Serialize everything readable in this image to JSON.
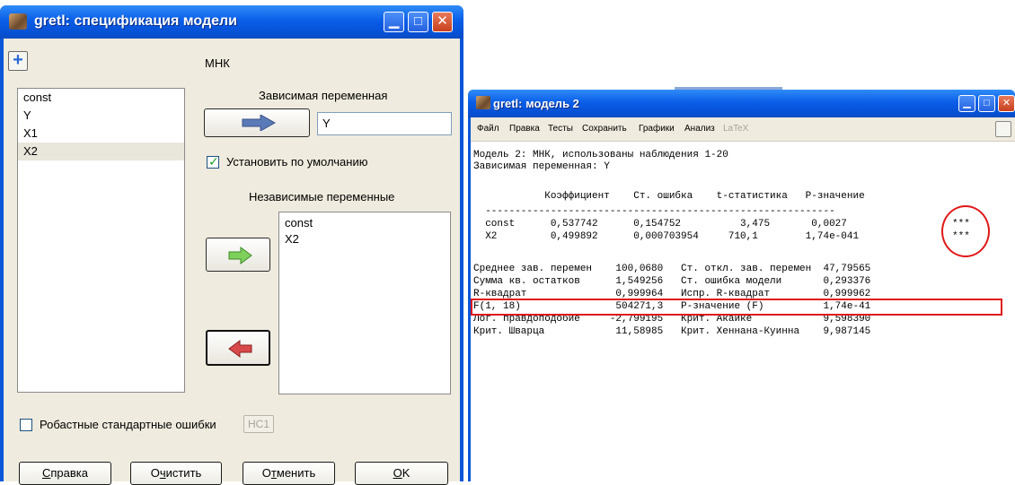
{
  "spec_window": {
    "title": "gretl: спецификация модели",
    "method": "МНК",
    "vars_list": [
      "const",
      "Y",
      "X1",
      "X2"
    ],
    "dep_label": "Зависимая переменная",
    "dep_value": "Y",
    "default_label": "Установить по умолчанию",
    "indep_label": "Независимые переменные",
    "indep_list": [
      "const",
      "X2"
    ],
    "robust_label": "Робастные стандартные ошибки",
    "hc1_label": "HC1",
    "buttons": {
      "help_u": "С",
      "help_rest": "правка",
      "clear_a": "О",
      "clear_u": "ч",
      "clear_rest": "истить",
      "cancel_a": "О",
      "cancel_u": "т",
      "cancel_rest": "менить",
      "ok_u": "O",
      "ok_rest": "K"
    },
    "titlebar_buttons": {
      "min": "▁",
      "max": "□",
      "close": "✕"
    }
  },
  "model_window": {
    "title": "gretl: модель 2",
    "menu": [
      "Файл",
      "Правка",
      "Тесты",
      "Сохранить",
      "Графики",
      "Анализ",
      "LaTeX"
    ],
    "output_lines": [
      "Модель 2: МНК, использованы наблюдения 1-20",
      "Зависимая переменная: Y",
      "",
      "            Коэффициент    Ст. ошибка    t-статистика   P-значение",
      "  -----------------------------------------------------------",
      "  const      0,537742      0,154752          3,475       0,0027",
      "  X2         0,499892      0,000703954     710,1        1,74e-041",
      "",
      "Среднее зав. перемен    100,0680   Ст. откл. зав. перемен  47,79565",
      "Сумма кв. остатков      1,549256   Ст. ошибка модели       0,293376",
      "R-квадрат               0,999964   Испр. R-квадрат         0,999962",
      "F(1, 18)                504271,3   P-значение (F)          1,74e-41",
      "Лог. правдоподобие     -2,799195   Крит. Акаике            9,598390",
      "Крит. Шварца            11,58985   Крит. Хеннана-Куинна    9,987145"
    ],
    "stars": [
      "***",
      "***"
    ]
  }
}
